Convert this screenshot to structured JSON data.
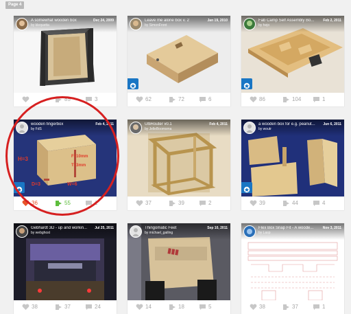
{
  "page": {
    "tag": "Page 4"
  },
  "colors": {
    "liked": "#e8552a",
    "collected": "#5dbd3c",
    "badge": "#1a76c4",
    "highlight": "#d62020"
  },
  "cards": [
    {
      "title": "A somewhat wooden box",
      "by": "by ",
      "author": "klequetta",
      "date": "Dec 24, 2009",
      "likes": "",
      "collects": "85",
      "comments": "3",
      "badge": false,
      "liked": false,
      "collected": false
    },
    {
      "title": "Leave me alone box v. 2",
      "by": "by ",
      "author": "SimonFront",
      "date": "Jan 19, 2010",
      "likes": "62",
      "collects": "72",
      "comments": "6",
      "badge": true,
      "liked": false,
      "collected": false
    },
    {
      "title": "Fab Camp Self Assembly Bo...",
      "by": "by ",
      "author": "hejo",
      "date": "Feb 2, 2011",
      "likes": "86",
      "collects": "104",
      "comments": "1",
      "badge": true,
      "liked": false,
      "collected": false
    },
    {
      "title": "wooden fingerbox",
      "by": "by ",
      "author": "FdS",
      "date": "Feb 4, 2011",
      "likes": "36",
      "collects": "55",
      "comments": "1",
      "badge": true,
      "liked": true,
      "collected": true,
      "overlay": {
        "h": "H=3",
        "f": "F=10mm",
        "t": "T=3mm",
        "d": "D=3",
        "w": "W=6"
      }
    },
    {
      "title": "UltiRouter v0.1",
      "by": "by ",
      "author": "JelleBoomsma",
      "date": "Feb 4, 2011",
      "likes": "37",
      "collects": "39",
      "comments": "2",
      "badge": false,
      "liked": false,
      "collected": false
    },
    {
      "title": "a wooden box for e.g. peanut...",
      "by": "by ",
      "author": "woutr",
      "date": "Jun 6, 2011",
      "likes": "39",
      "collects": "44",
      "comments": "4",
      "badge": true,
      "liked": false,
      "collected": false
    },
    {
      "title": "Gebhardt 3D - up and workin...",
      "by": "by ",
      "author": "webghost",
      "date": "Jul 25, 2011",
      "likes": "38",
      "collects": "37",
      "comments": "24",
      "badge": false,
      "liked": false,
      "collected": false
    },
    {
      "title": "Thingomatic Feet",
      "by": "by ",
      "author": "michael_gailing",
      "date": "Sep 10, 2011",
      "likes": "14",
      "collects": "18",
      "comments": "5",
      "badge": false,
      "liked": false,
      "collected": false
    },
    {
      "title": "Flex Box Snap Fit - A woode...",
      "by": "by ",
      "author": "Lasp",
      "date": "Nov 3, 2011",
      "likes": "38",
      "collects": "37",
      "comments": "1",
      "badge": false,
      "liked": false,
      "collected": false
    }
  ],
  "icons": {
    "like": "heart-icon",
    "collect": "collect-icon",
    "comment": "comment-icon",
    "badge": "featured-badge-icon"
  }
}
